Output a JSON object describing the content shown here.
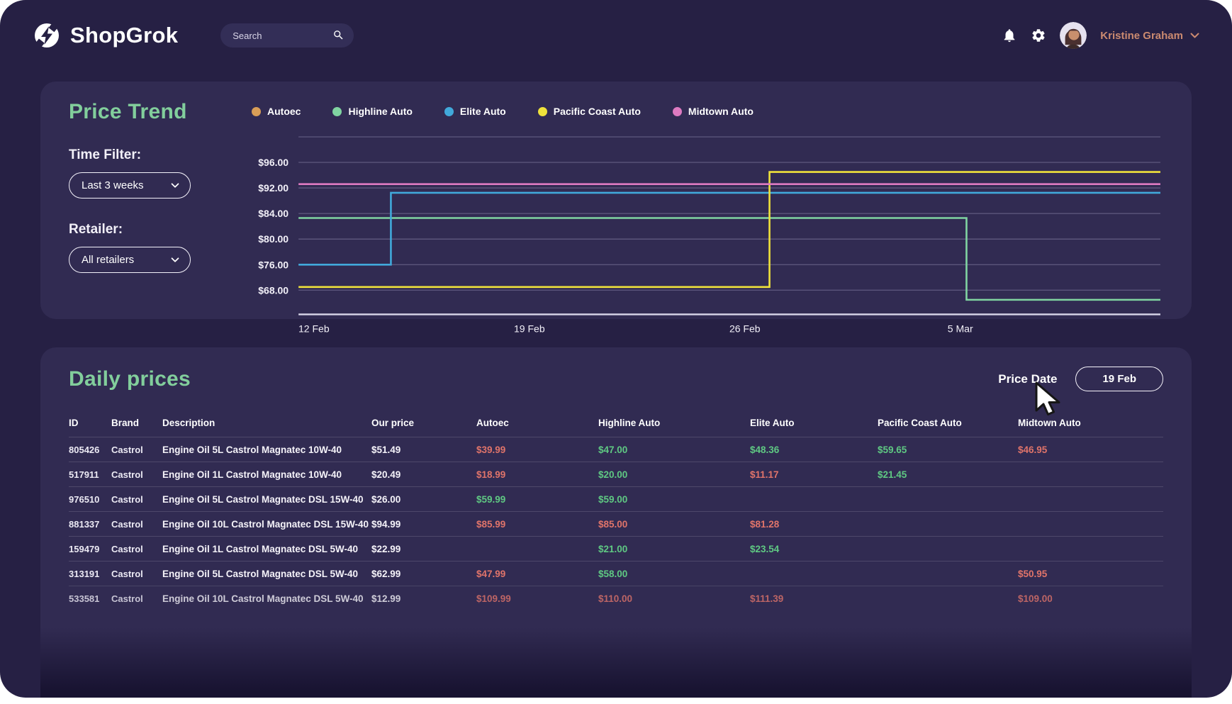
{
  "app": {
    "name": "ShopGrok"
  },
  "topbar": {
    "search_placeholder": "Search",
    "user_name": "Kristine Graham"
  },
  "price_trend": {
    "title": "Price Trend",
    "time_filter_label": "Time Filter:",
    "time_filter_value": "Last 3 weeks",
    "retailer_label": "Retailer:",
    "retailer_value": "All retailers"
  },
  "chart_data": {
    "type": "line",
    "line_style": "step",
    "title": "Price Trend",
    "legend_position": "top",
    "grid": "horizontal-only",
    "x_domain": [
      0,
      28
    ],
    "x_ticks": [
      {
        "x": 0.5,
        "label": "12 Feb"
      },
      {
        "x": 7.5,
        "label": "19 Feb"
      },
      {
        "x": 14.5,
        "label": "26 Feb"
      },
      {
        "x": 21.5,
        "label": "5 Mar"
      }
    ],
    "unlabeled_top_gridline": true,
    "y_gridlines": [
      {
        "value": 96,
        "label": "$96.00"
      },
      {
        "value": 92,
        "label": "$92.00"
      },
      {
        "value": 84,
        "label": "$84.00"
      },
      {
        "value": 80,
        "label": "$80.00"
      },
      {
        "value": 76,
        "label": "$76.00"
      },
      {
        "value": 68,
        "label": "$68.00"
      }
    ],
    "series": [
      {
        "name": "Autoec",
        "color": "#d99e57",
        "points": []
      },
      {
        "name": "Highline Auto",
        "color": "#80d4a1",
        "points": [
          {
            "x": 0,
            "y": 83.3
          },
          {
            "x": 21.7,
            "y": 83.3
          },
          {
            "x": 21.7,
            "y": 65.0
          },
          {
            "x": 28,
            "y": 65.0
          }
        ]
      },
      {
        "name": "Elite Auto",
        "color": "#41a9db",
        "points": [
          {
            "x": 0,
            "y": 76.0
          },
          {
            "x": 3,
            "y": 76.0
          },
          {
            "x": 3,
            "y": 90.5
          },
          {
            "x": 28,
            "y": 90.5
          }
        ]
      },
      {
        "name": "Pacific Coast Auto",
        "color": "#efe23b",
        "points": [
          {
            "x": 0,
            "y": 69.0
          },
          {
            "x": 15.3,
            "y": 69.0
          },
          {
            "x": 15.3,
            "y": 94.5
          },
          {
            "x": 28,
            "y": 94.5
          }
        ]
      },
      {
        "name": "Midtown Auto",
        "color": "#de7ac1",
        "points": [
          {
            "x": 0,
            "y": 92.6
          },
          {
            "x": 28,
            "y": 92.6
          }
        ]
      }
    ]
  },
  "daily_prices": {
    "title": "Daily prices",
    "price_date_label": "Price Date",
    "price_date_value": "19 Feb",
    "columns": [
      "ID",
      "Brand",
      "Description",
      "Our price",
      "Autoec",
      "Highline Auto",
      "Elite Auto",
      "Pacific Coast Auto",
      "Midtown Auto"
    ],
    "rows": [
      {
        "id": "805426",
        "brand": "Castrol",
        "description": "Engine Oil 5L Castrol Magnatec 10W-40",
        "our_price": "$51.49",
        "competitors": [
          {
            "value": "$39.99",
            "tone": "red"
          },
          {
            "value": "$47.00",
            "tone": "green"
          },
          {
            "value": "$48.36",
            "tone": "green"
          },
          {
            "value": "$59.65",
            "tone": "green"
          },
          {
            "value": "$46.95",
            "tone": "red"
          }
        ]
      },
      {
        "id": "517911",
        "brand": "Castrol",
        "description": "Engine Oil 1L Castrol Magnatec 10W-40",
        "our_price": "$20.49",
        "competitors": [
          {
            "value": "$18.99",
            "tone": "red"
          },
          {
            "value": "$20.00",
            "tone": "green"
          },
          {
            "value": "$11.17",
            "tone": "red"
          },
          {
            "value": "$21.45",
            "tone": "green"
          },
          {
            "value": "",
            "tone": ""
          }
        ]
      },
      {
        "id": "976510",
        "brand": "Castrol",
        "description": "Engine Oil 5L Castrol Magnatec DSL 15W-40",
        "our_price": "$26.00",
        "competitors": [
          {
            "value": "$59.99",
            "tone": "green"
          },
          {
            "value": "$59.00",
            "tone": "green"
          },
          {
            "value": "",
            "tone": ""
          },
          {
            "value": "",
            "tone": ""
          },
          {
            "value": "",
            "tone": ""
          }
        ]
      },
      {
        "id": "881337",
        "brand": "Castrol",
        "description": "Engine Oil 10L Castrol Magnatec DSL 15W-40",
        "our_price": "$94.99",
        "competitors": [
          {
            "value": "$85.99",
            "tone": "red"
          },
          {
            "value": "$85.00",
            "tone": "red"
          },
          {
            "value": "$81.28",
            "tone": "red"
          },
          {
            "value": "",
            "tone": ""
          },
          {
            "value": "",
            "tone": ""
          }
        ]
      },
      {
        "id": "159479",
        "brand": "Castrol",
        "description": "Engine Oil 1L Castrol Magnatec DSL 5W-40",
        "our_price": "$22.99",
        "competitors": [
          {
            "value": "",
            "tone": ""
          },
          {
            "value": "$21.00",
            "tone": "green"
          },
          {
            "value": "$23.54",
            "tone": "green"
          },
          {
            "value": "",
            "tone": ""
          },
          {
            "value": "",
            "tone": ""
          }
        ]
      },
      {
        "id": "313191",
        "brand": "Castrol",
        "description": "Engine Oil 5L Castrol Magnatec DSL 5W-40",
        "our_price": "$62.99",
        "competitors": [
          {
            "value": "$47.99",
            "tone": "red"
          },
          {
            "value": "$58.00",
            "tone": "green"
          },
          {
            "value": "",
            "tone": ""
          },
          {
            "value": "",
            "tone": ""
          },
          {
            "value": "$50.95",
            "tone": "red"
          }
        ]
      },
      {
        "id": "533581",
        "brand": "Castrol",
        "description": "Engine Oil 10L Castrol Magnatec DSL 5W-40",
        "our_price": "$12.99",
        "competitors": [
          {
            "value": "$109.99",
            "tone": "red"
          },
          {
            "value": "$110.00",
            "tone": "red"
          },
          {
            "value": "$111.39",
            "tone": "red"
          },
          {
            "value": "",
            "tone": ""
          },
          {
            "value": "$109.00",
            "tone": "red"
          }
        ]
      }
    ]
  },
  "colors": {
    "page_bg": "#262044",
    "card_bg": "#312b52",
    "accent_green": "#82ce9c",
    "price_lower": "#e0746a",
    "price_higher": "#5fc983",
    "user_name": "#cb8a70"
  }
}
